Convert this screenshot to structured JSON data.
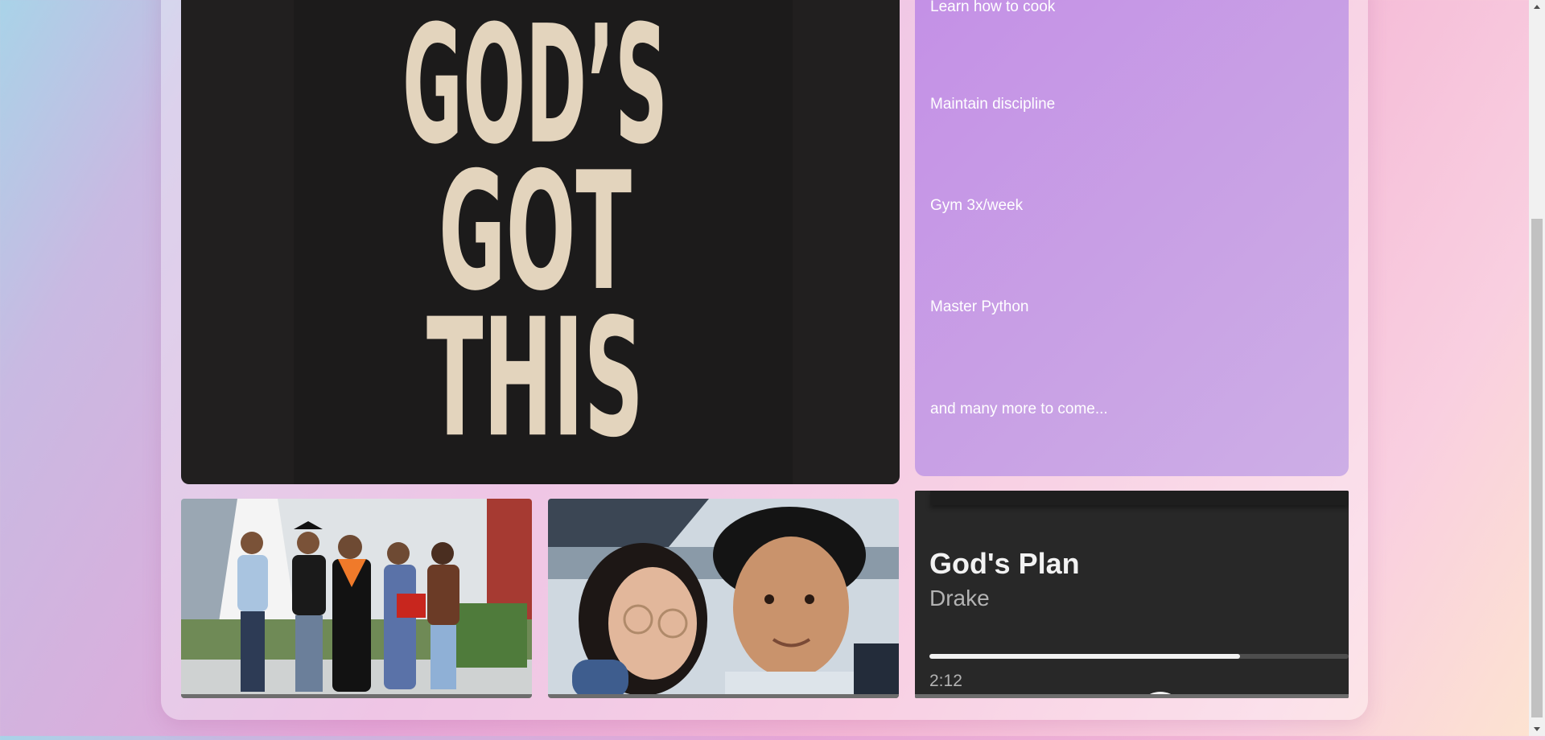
{
  "poster": {
    "lines": [
      "GOD’S",
      "GOT",
      "THIS"
    ],
    "text_color": "#e3d4bd",
    "background": "#211f1f"
  },
  "goals": {
    "items": [
      "Learn how to cook",
      "Maintain discipline",
      "Gym 3x/week",
      "Master Python",
      "and many more to come..."
    ]
  },
  "photos": [
    {
      "name": "graduation-family-photo"
    },
    {
      "name": "couple-selfie-photo"
    }
  ],
  "music": {
    "title": "God's Plan",
    "artist": "Drake",
    "elapsed": "2:12",
    "progress_fraction": 0.74
  },
  "colors": {
    "accent_purple": "#c490e6",
    "player_bg": "#282828"
  }
}
